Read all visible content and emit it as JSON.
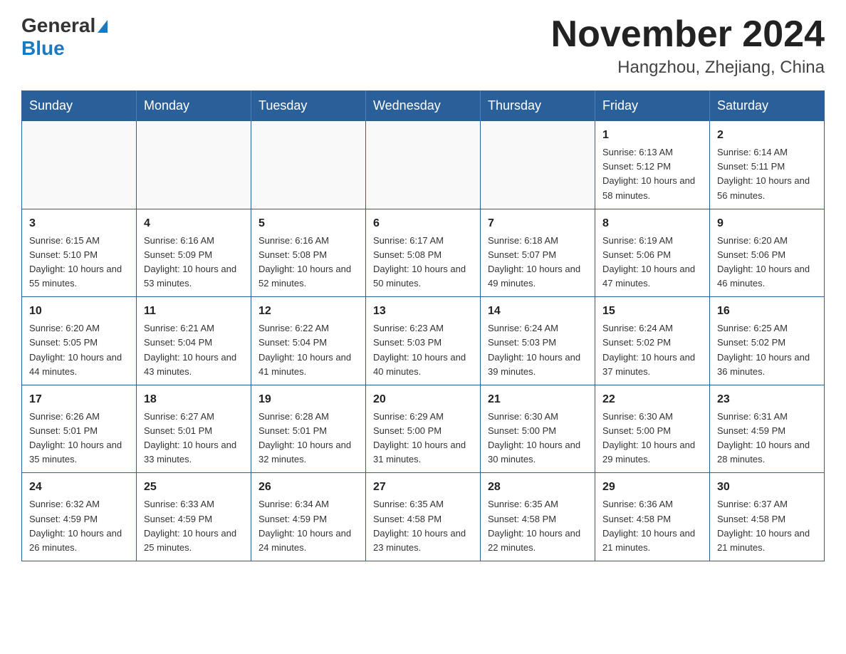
{
  "header": {
    "logo_general": "General",
    "logo_blue": "Blue",
    "month_title": "November 2024",
    "location": "Hangzhou, Zhejiang, China"
  },
  "days_of_week": [
    "Sunday",
    "Monday",
    "Tuesday",
    "Wednesday",
    "Thursday",
    "Friday",
    "Saturday"
  ],
  "weeks": [
    [
      {
        "day": "",
        "info": ""
      },
      {
        "day": "",
        "info": ""
      },
      {
        "day": "",
        "info": ""
      },
      {
        "day": "",
        "info": ""
      },
      {
        "day": "",
        "info": ""
      },
      {
        "day": "1",
        "info": "Sunrise: 6:13 AM\nSunset: 5:12 PM\nDaylight: 10 hours and 58 minutes."
      },
      {
        "day": "2",
        "info": "Sunrise: 6:14 AM\nSunset: 5:11 PM\nDaylight: 10 hours and 56 minutes."
      }
    ],
    [
      {
        "day": "3",
        "info": "Sunrise: 6:15 AM\nSunset: 5:10 PM\nDaylight: 10 hours and 55 minutes."
      },
      {
        "day": "4",
        "info": "Sunrise: 6:16 AM\nSunset: 5:09 PM\nDaylight: 10 hours and 53 minutes."
      },
      {
        "day": "5",
        "info": "Sunrise: 6:16 AM\nSunset: 5:08 PM\nDaylight: 10 hours and 52 minutes."
      },
      {
        "day": "6",
        "info": "Sunrise: 6:17 AM\nSunset: 5:08 PM\nDaylight: 10 hours and 50 minutes."
      },
      {
        "day": "7",
        "info": "Sunrise: 6:18 AM\nSunset: 5:07 PM\nDaylight: 10 hours and 49 minutes."
      },
      {
        "day": "8",
        "info": "Sunrise: 6:19 AM\nSunset: 5:06 PM\nDaylight: 10 hours and 47 minutes."
      },
      {
        "day": "9",
        "info": "Sunrise: 6:20 AM\nSunset: 5:06 PM\nDaylight: 10 hours and 46 minutes."
      }
    ],
    [
      {
        "day": "10",
        "info": "Sunrise: 6:20 AM\nSunset: 5:05 PM\nDaylight: 10 hours and 44 minutes."
      },
      {
        "day": "11",
        "info": "Sunrise: 6:21 AM\nSunset: 5:04 PM\nDaylight: 10 hours and 43 minutes."
      },
      {
        "day": "12",
        "info": "Sunrise: 6:22 AM\nSunset: 5:04 PM\nDaylight: 10 hours and 41 minutes."
      },
      {
        "day": "13",
        "info": "Sunrise: 6:23 AM\nSunset: 5:03 PM\nDaylight: 10 hours and 40 minutes."
      },
      {
        "day": "14",
        "info": "Sunrise: 6:24 AM\nSunset: 5:03 PM\nDaylight: 10 hours and 39 minutes."
      },
      {
        "day": "15",
        "info": "Sunrise: 6:24 AM\nSunset: 5:02 PM\nDaylight: 10 hours and 37 minutes."
      },
      {
        "day": "16",
        "info": "Sunrise: 6:25 AM\nSunset: 5:02 PM\nDaylight: 10 hours and 36 minutes."
      }
    ],
    [
      {
        "day": "17",
        "info": "Sunrise: 6:26 AM\nSunset: 5:01 PM\nDaylight: 10 hours and 35 minutes."
      },
      {
        "day": "18",
        "info": "Sunrise: 6:27 AM\nSunset: 5:01 PM\nDaylight: 10 hours and 33 minutes."
      },
      {
        "day": "19",
        "info": "Sunrise: 6:28 AM\nSunset: 5:01 PM\nDaylight: 10 hours and 32 minutes."
      },
      {
        "day": "20",
        "info": "Sunrise: 6:29 AM\nSunset: 5:00 PM\nDaylight: 10 hours and 31 minutes."
      },
      {
        "day": "21",
        "info": "Sunrise: 6:30 AM\nSunset: 5:00 PM\nDaylight: 10 hours and 30 minutes."
      },
      {
        "day": "22",
        "info": "Sunrise: 6:30 AM\nSunset: 5:00 PM\nDaylight: 10 hours and 29 minutes."
      },
      {
        "day": "23",
        "info": "Sunrise: 6:31 AM\nSunset: 4:59 PM\nDaylight: 10 hours and 28 minutes."
      }
    ],
    [
      {
        "day": "24",
        "info": "Sunrise: 6:32 AM\nSunset: 4:59 PM\nDaylight: 10 hours and 26 minutes."
      },
      {
        "day": "25",
        "info": "Sunrise: 6:33 AM\nSunset: 4:59 PM\nDaylight: 10 hours and 25 minutes."
      },
      {
        "day": "26",
        "info": "Sunrise: 6:34 AM\nSunset: 4:59 PM\nDaylight: 10 hours and 24 minutes."
      },
      {
        "day": "27",
        "info": "Sunrise: 6:35 AM\nSunset: 4:58 PM\nDaylight: 10 hours and 23 minutes."
      },
      {
        "day": "28",
        "info": "Sunrise: 6:35 AM\nSunset: 4:58 PM\nDaylight: 10 hours and 22 minutes."
      },
      {
        "day": "29",
        "info": "Sunrise: 6:36 AM\nSunset: 4:58 PM\nDaylight: 10 hours and 21 minutes."
      },
      {
        "day": "30",
        "info": "Sunrise: 6:37 AM\nSunset: 4:58 PM\nDaylight: 10 hours and 21 minutes."
      }
    ]
  ]
}
